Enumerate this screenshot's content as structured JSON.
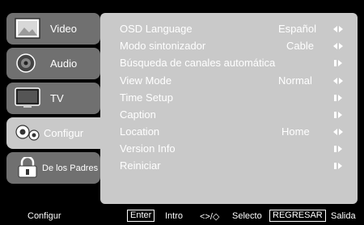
{
  "sidebar": {
    "items": [
      {
        "label": "Video",
        "icon": "video-picture-icon"
      },
      {
        "label": "Audio",
        "icon": "speaker-icon"
      },
      {
        "label": "TV",
        "icon": "tv-icon"
      },
      {
        "label": "Configur",
        "icon": "gears-icon",
        "active": true
      },
      {
        "label": "De los Padres",
        "icon": "padlock-icon"
      }
    ]
  },
  "menu": {
    "rows": [
      {
        "name": "OSD Language",
        "value": "Español",
        "arrow": "left-right"
      },
      {
        "name": "Modo sintonizador",
        "value": "Cable",
        "arrow": "left-right"
      },
      {
        "name": "Búsqueda de canales automática",
        "value": "",
        "arrow": "enter"
      },
      {
        "name": "View Mode",
        "value": "Normal",
        "arrow": "left-right"
      },
      {
        "name": "Time Setup",
        "value": "",
        "arrow": "enter"
      },
      {
        "name": "Caption",
        "value": "",
        "arrow": "enter"
      },
      {
        "name": "Location",
        "value": "Home",
        "arrow": "left-right"
      },
      {
        "name": "Version Info",
        "value": "",
        "arrow": "enter"
      },
      {
        "name": "Reiniciar",
        "value": "",
        "arrow": "enter"
      }
    ]
  },
  "footer": {
    "section": "Configur",
    "enter_key": "Enter",
    "enter_action": "Intro",
    "nav_keys": "<>/◇",
    "nav_action": "Selecto",
    "back_key": "REGRESAR",
    "back_action": "Salida"
  },
  "colors": {
    "background": "#000000",
    "panel": "#c9c9c9",
    "tab": "#707070",
    "text": "#ffffff"
  }
}
